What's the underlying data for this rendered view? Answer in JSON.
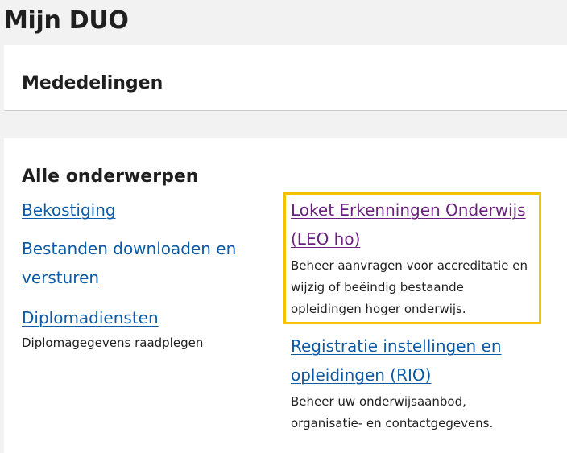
{
  "page": {
    "title": "Mijn DUO"
  },
  "announcements": {
    "heading": "Mededelingen"
  },
  "topics": {
    "heading": "Alle onderwerpen",
    "left": [
      {
        "label": "Bekostiging",
        "description": ""
      },
      {
        "label": "Bestanden downloaden en versturen",
        "description": ""
      },
      {
        "label": "Diplomadiensten",
        "description": "Diplomagegevens raadplegen"
      }
    ],
    "right": [
      {
        "label": "Loket Erkenningen Onderwijs (LEO ho)",
        "description": "Beheer aanvragen voor accreditatie en wijzig of beëindig bestaande opleidingen hoger onderwijs."
      },
      {
        "label": "Registratie instellingen en opleidingen (RIO)",
        "description": "Beheer uw onderwijsaanbod, organisatie- en contactgegevens."
      }
    ]
  },
  "colors": {
    "link": "#0b5aa6",
    "visited_link": "#6b1f7f",
    "highlight": "#f2c400",
    "background": "#f2f2f2"
  }
}
